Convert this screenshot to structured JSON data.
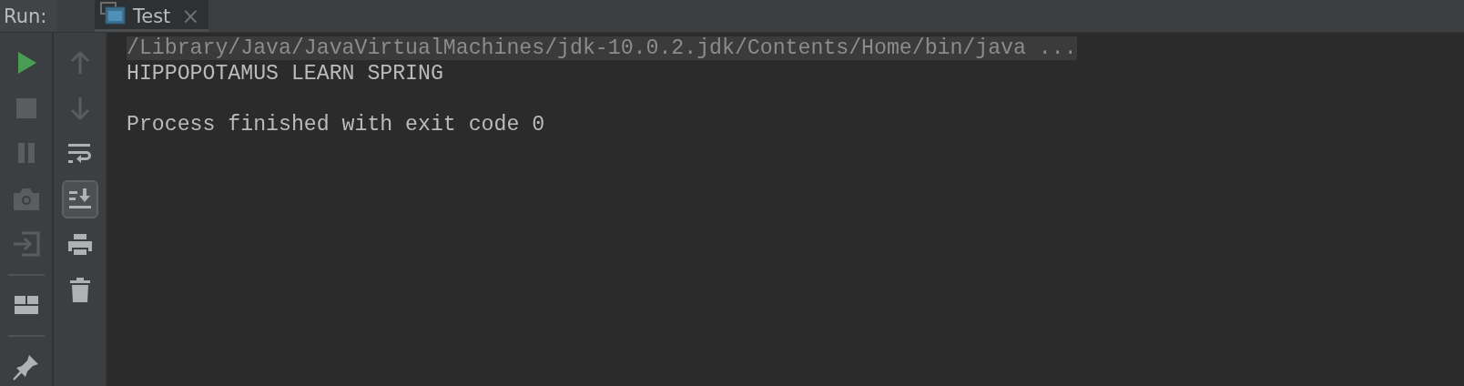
{
  "header": {
    "label": "Run:",
    "tabs": [
      {
        "label": "Test",
        "selected": true,
        "close": "×"
      }
    ]
  },
  "left_toolbar": [
    {
      "kind": "run",
      "disabled": false
    },
    {
      "kind": "stop",
      "disabled": true
    },
    {
      "kind": "pause",
      "disabled": true
    },
    {
      "kind": "camera",
      "disabled": true
    },
    {
      "kind": "exit",
      "disabled": true
    },
    {
      "kind": "divider"
    },
    {
      "kind": "layout",
      "disabled": false
    },
    {
      "kind": "divider"
    },
    {
      "kind": "pin",
      "disabled": false
    }
  ],
  "right_toolbar": [
    {
      "kind": "up",
      "disabled": true,
      "on": false
    },
    {
      "kind": "down",
      "disabled": true,
      "on": false
    },
    {
      "kind": "wrap",
      "disabled": false,
      "on": false
    },
    {
      "kind": "scroll-end",
      "disabled": false,
      "on": true
    },
    {
      "kind": "print",
      "disabled": false,
      "on": false
    },
    {
      "kind": "trash",
      "disabled": false,
      "on": false
    }
  ],
  "console": {
    "lines": [
      {
        "kind": "command",
        "text": "/Library/Java/JavaVirtualMachines/jdk-10.0.2.jdk/Contents/Home/bin/java ..."
      },
      {
        "kind": "output",
        "text": "HIPPOPOTAMUS LEARN SPRING"
      },
      {
        "kind": "blank"
      },
      {
        "kind": "output",
        "text": "Process finished with exit code 0"
      }
    ]
  }
}
